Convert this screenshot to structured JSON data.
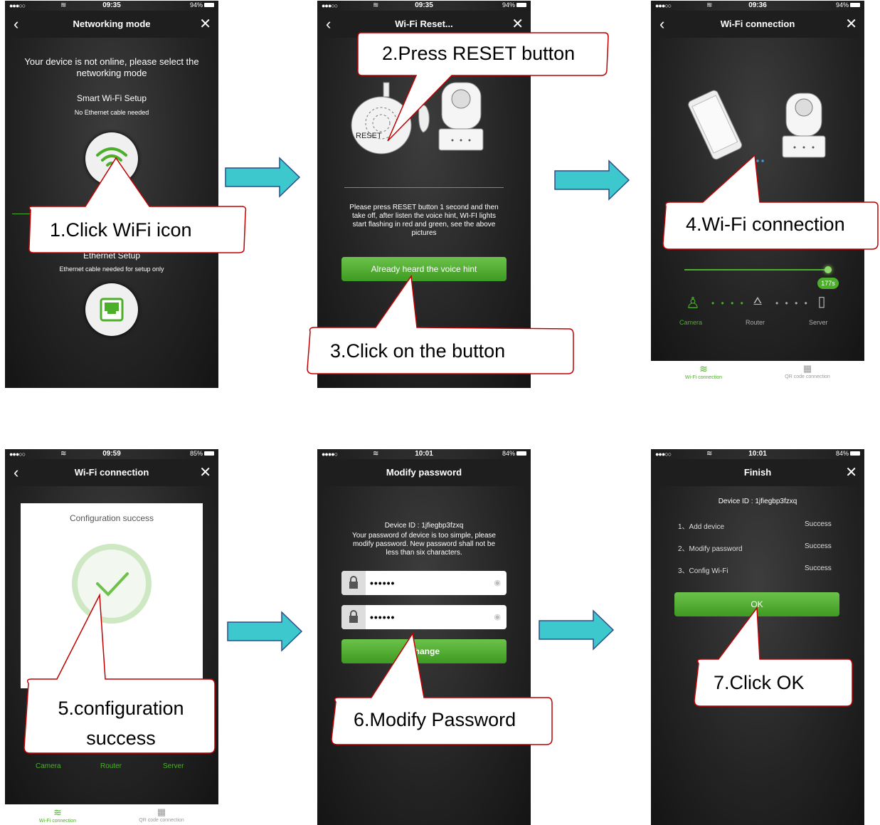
{
  "screens": [
    {
      "status": {
        "signal": "●●●○○",
        "time": "09:35",
        "battery": "94%"
      },
      "title": "Networking mode",
      "message": "Your device is not online, please select the networking mode",
      "smart_title": "Smart Wi-Fi Setup",
      "smart_sub": "No Ethernet cable needed",
      "eth_title": "Ethernet Setup",
      "eth_sub": "Ethernet cable needed for setup only"
    },
    {
      "status": {
        "signal": "●●●○○",
        "time": "09:35",
        "battery": "94%"
      },
      "title": "Wi-Fi Reset...",
      "reset_label": "RESET",
      "instruction": "Please press RESET button 1 second and then take off, after listen the voice hint, WI-FI lights start flashing in red and green, see the above pictures",
      "button": "Already heard the voice hint"
    },
    {
      "status": {
        "signal": "●●●○○",
        "time": "09:36",
        "battery": "94%"
      },
      "title": "Wi-Fi connection",
      "timer": "177s",
      "nodes": [
        "Camera",
        "Router",
        "Server"
      ],
      "tabs": [
        "Wi-Fi connection",
        "QR code connection"
      ]
    },
    {
      "status": {
        "signal": "●●●○○",
        "time": "09:59",
        "battery": "85%"
      },
      "title": "Wi-Fi connection",
      "dialog_title": "Configuration success",
      "nodes": [
        "Camera",
        "Router",
        "Server"
      ],
      "tabs": [
        "Wi-Fi connection",
        "QR code connection"
      ]
    },
    {
      "status": {
        "signal": "●●●●○",
        "time": "10:01",
        "battery": "84%"
      },
      "title": "Modify password",
      "device_id": "Device ID : 1jfiegbp3fzxq",
      "message": "Your password of device is too simple, please modify password. New password shall not be less than six characters.",
      "password_mask": "••••••",
      "confirm_mask": "••••••",
      "button": "Change"
    },
    {
      "status": {
        "signal": "●●●○○",
        "time": "10:01",
        "battery": "84%"
      },
      "title": "Finish",
      "device_id": "Device ID : 1jfiegbp3fzxq",
      "items": [
        {
          "label": "1、Add device",
          "status": "Success"
        },
        {
          "label": "2、Modify password",
          "status": "Success"
        },
        {
          "label": "3、Config Wi-Fi",
          "status": "Success"
        }
      ],
      "button": "OK"
    }
  ],
  "callouts": [
    "1.Click WiFi icon",
    "2.Press RESET button",
    "3.Click on the button",
    "4.Wi-Fi connection",
    "5.configuration success",
    "6.Modify Password",
    "7.Click OK"
  ],
  "colors": {
    "arrow": "#3cc8cc",
    "accent_green": "#5cb83a",
    "callout_border": "#c00000"
  }
}
